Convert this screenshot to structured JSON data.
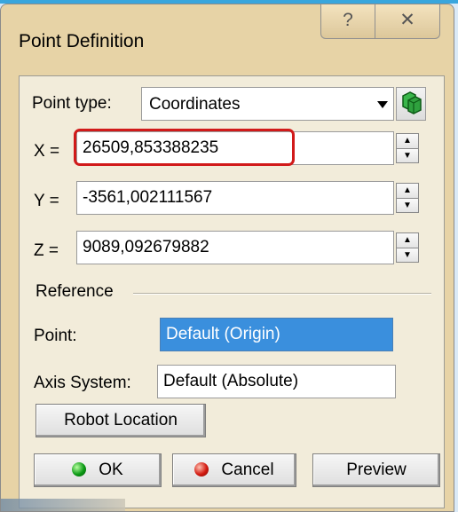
{
  "dialog": {
    "title": "Point Definition",
    "help_glyph": "?",
    "close_glyph": "✕"
  },
  "point_type": {
    "label": "Point type:",
    "value": "Coordinates"
  },
  "coordinates": {
    "x_label": "X =",
    "x_value": "26509,853388235",
    "y_label": "Y =",
    "y_value": "-3561,002111567",
    "z_label": "Z =",
    "z_value": "9089,092679882"
  },
  "reference": {
    "group_label": "Reference",
    "point_label": "Point:",
    "point_value": "Default (Origin)",
    "axis_label": "Axis System:",
    "axis_value": "Default (Absolute)"
  },
  "robot_location_label": "Robot Location",
  "buttons": {
    "ok": "OK",
    "cancel": "Cancel",
    "preview": "Preview"
  },
  "colors": {
    "highlight_border": "#d11a1a",
    "selection": "#3a8fdd",
    "frame": "#e7d3a6",
    "panel": "#f2ecda"
  }
}
